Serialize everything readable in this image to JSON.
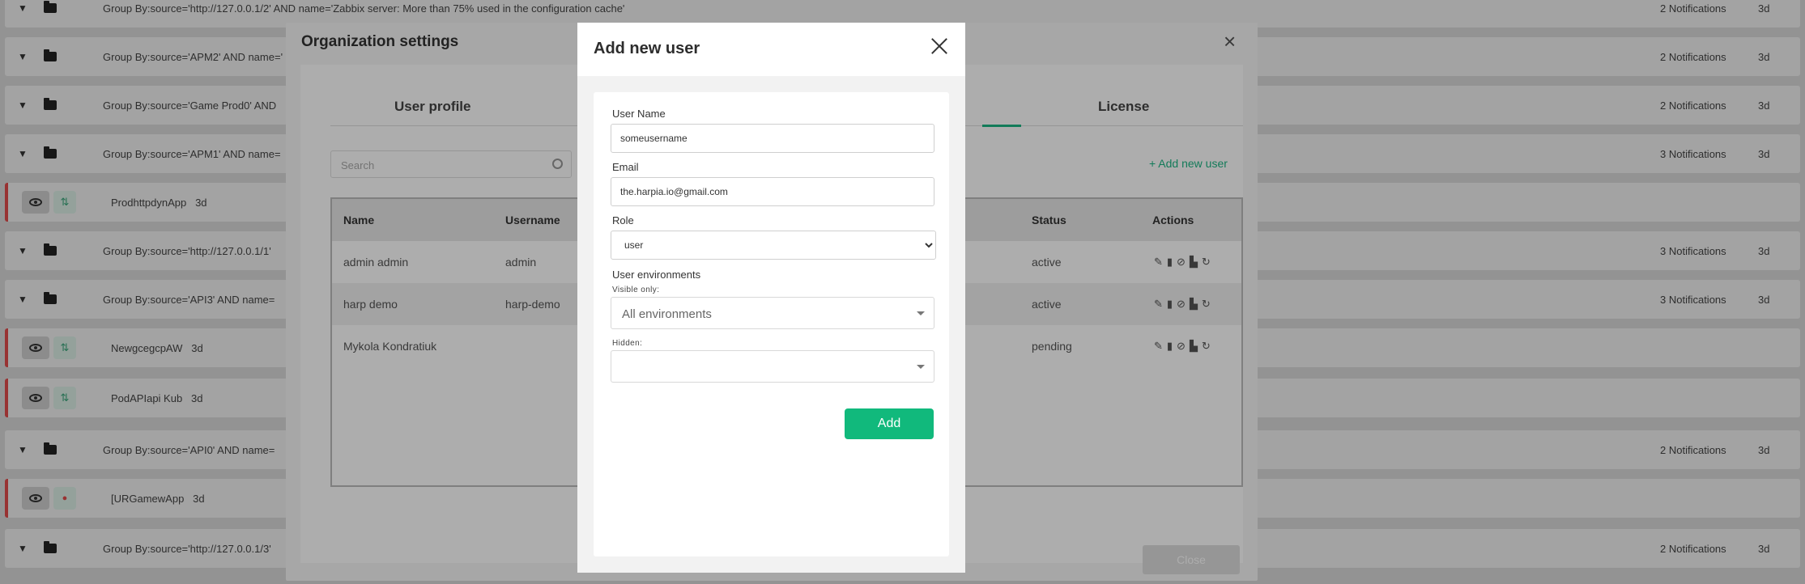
{
  "background_rows": [
    {
      "kind": "group",
      "text": "Group By:source='http://127.0.0.1/2' AND name='Zabbix server: More than 75% used in the configuration cache'",
      "notifications": "2 Notifications",
      "age": "3d"
    },
    {
      "kind": "group",
      "text": "Group By:source='APM2' AND name='",
      "notifications": "2 Notifications",
      "age": "3d"
    },
    {
      "kind": "group",
      "text": "Group By:source='Game Prod0' AND",
      "notifications": "2 Notifications",
      "age": "3d"
    },
    {
      "kind": "group",
      "text": "Group By:source='APM1' AND name=",
      "notifications": "3 Notifications",
      "age": "3d"
    },
    {
      "kind": "app",
      "text": "ProdhttpdynApp",
      "age": "3d",
      "status": "ok"
    },
    {
      "kind": "group",
      "text": "Group By:source='http://127.0.0.1/1'",
      "notifications": "3 Notifications",
      "age": "3d"
    },
    {
      "kind": "group",
      "text": "Group By:source='API3' AND name=",
      "notifications": "3 Notifications",
      "age": "3d"
    },
    {
      "kind": "app",
      "text": "NewgcegcpAW",
      "age": "3d",
      "status": "ok"
    },
    {
      "kind": "app",
      "text": "PodAPIapi Kub",
      "age": "3d",
      "status": "ok"
    },
    {
      "kind": "group",
      "text": "Group By:source='API0' AND name=",
      "notifications": "2 Notifications",
      "age": "3d"
    },
    {
      "kind": "app",
      "text": "[URGamewApp",
      "age": "3d",
      "status": "alert"
    },
    {
      "kind": "group",
      "text": "Group By:source='http://127.0.0.1/3'",
      "notifications": "2 Notifications",
      "age": "3d"
    }
  ],
  "org_settings": {
    "title": "Organization settings",
    "tabs": [
      "User profile",
      "License"
    ],
    "search_placeholder": "Search",
    "add_new_user_link": "+ Add new user",
    "table": {
      "headers": [
        "Name",
        "Username",
        "Status",
        "Actions"
      ],
      "rows": [
        {
          "name": "admin admin",
          "username": "admin",
          "status": "active"
        },
        {
          "name": "harp demo",
          "username": "harp-demo",
          "status": "active"
        },
        {
          "name": "Mykola Kondratiuk",
          "username": "",
          "status": "pending"
        }
      ]
    },
    "close_label": "Close"
  },
  "modal": {
    "title": "Add new user",
    "user_name_label": "User Name",
    "user_name_value": "someusername",
    "email_label": "Email",
    "email_value": "the.harpia.io@gmail.com",
    "role_label": "Role",
    "role_value": "user",
    "environments_label": "User environments",
    "visible_only_label": "Visible only:",
    "visible_only_value": "All environments",
    "hidden_label": "Hidden:",
    "hidden_value": "",
    "add_label": "Add"
  },
  "colors": {
    "accent": "#11b97c",
    "alert_border": "#e04b4b"
  }
}
